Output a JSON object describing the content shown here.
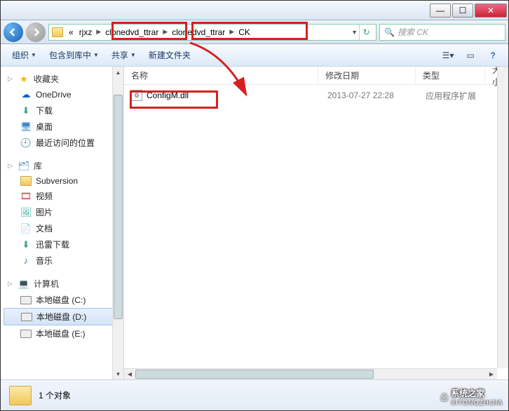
{
  "window": {
    "min": "—",
    "max": "☐",
    "close": "✕"
  },
  "nav": {
    "crumb_prefix": "«",
    "crumbs": [
      "rjxz",
      "clonedvd_ttrar",
      "clonedvd_ttrar",
      "CK"
    ],
    "refresh": "↻",
    "search_placeholder": "搜索 CK",
    "search_icon": "🔍"
  },
  "toolbar": {
    "organize": "组织",
    "include": "包含到库中",
    "share": "共享",
    "newfolder": "新建文件夹",
    "view_icon": "☰▾",
    "help_icon": "?"
  },
  "sidebar": {
    "favorites": {
      "label": "收藏夹",
      "items": [
        {
          "key": "onedrive",
          "label": "OneDrive"
        },
        {
          "key": "downloads",
          "label": "下载"
        },
        {
          "key": "desktop",
          "label": "桌面"
        },
        {
          "key": "recent",
          "label": "最近访问的位置"
        }
      ]
    },
    "libraries": {
      "label": "库",
      "items": [
        {
          "key": "subversion",
          "label": "Subversion"
        },
        {
          "key": "videos",
          "label": "视频"
        },
        {
          "key": "pictures",
          "label": "图片"
        },
        {
          "key": "documents",
          "label": "文档"
        },
        {
          "key": "xunlei",
          "label": "迅雷下载"
        },
        {
          "key": "music",
          "label": "音乐"
        }
      ]
    },
    "computer": {
      "label": "计算机",
      "items": [
        {
          "key": "c",
          "label": "本地磁盘 (C:)"
        },
        {
          "key": "d",
          "label": "本地磁盘 (D:)",
          "selected": true
        },
        {
          "key": "e",
          "label": "本地磁盘 (E:)"
        }
      ]
    }
  },
  "columns": {
    "name": "名称",
    "date": "修改日期",
    "type": "类型",
    "size": "大小"
  },
  "files": [
    {
      "name": "ConfigM.dll",
      "date": "2013-07-27 22:28",
      "type": "应用程序扩展"
    }
  ],
  "status": {
    "count": "1 个对象"
  },
  "watermark": {
    "brand": "系统之家",
    "sub": "XITONGZHIJIA"
  }
}
